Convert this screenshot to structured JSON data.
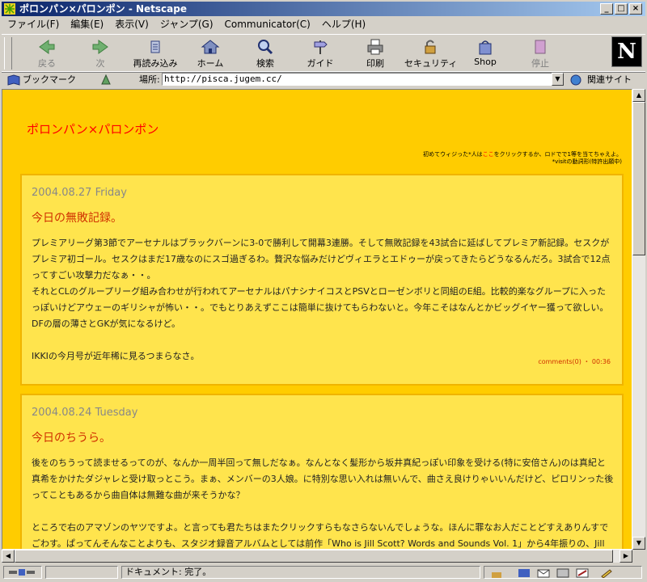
{
  "window": {
    "title": "ポロンパン×パロンポン - Netscape"
  },
  "menu": [
    "ファイル(F)",
    "編集(E)",
    "表示(V)",
    "ジャンプ(G)",
    "Communicator(C)",
    "ヘルプ(H)"
  ],
  "toolbar": {
    "back": "戻る",
    "forward": "次",
    "reload": "再読み込み",
    "home": "ホーム",
    "search": "検索",
    "guide": "ガイド",
    "print": "印刷",
    "security": "セキュリティ",
    "shop": "Shop",
    "stop": "停止",
    "logo": "N"
  },
  "location": {
    "bookmarks": "ブックマーク",
    "label": "場所:",
    "url": "http://pisca.jugem.cc/",
    "related": "関連サイト"
  },
  "status": {
    "text": "ドキュメント: 完了。"
  },
  "page": {
    "site_title": "ポロンパン×パロンポン",
    "note_line1_a": "初めてウィジった*人は",
    "note_link": "ここ",
    "note_line1_b": "をクリックするか、ロドでで1等を当てちゃえよ。",
    "note_line2": "*visitの動詞形(特許出願中)",
    "entries": [
      {
        "date": "2004.08.27 Friday",
        "title": "今日の無敗記録。",
        "p1": "プレミアリーグ第3節でアーセナルはブラックバーンに3-0で勝利して開幕3連勝。そして無敗記録を43試合に延ばしてプレミア新記録。セスクがプレミア初ゴール。セスクはまだ17歳なのにスゴ過ぎるわ。贅沢な悩みだけどヴィエラとエドゥーが戻ってきたらどうなるんだろ。3試合で12点ってすごい攻撃力だなぁ・・。",
        "p2": "それとCLのグループリーグ組み合わせが行われてアーセナルはパナシナイコスとPSVとローゼンボリと同組のE組。比較的楽なグループに入ったっぽいけどアウェーのギリシャが怖い・・。でもとりあえずここは簡単に抜けてもらわないと。今年こそはなんとかビッグイヤー獲って欲しい。DFの層の薄さとGKが気になるけど。",
        "p3": "IKKIの今月号が近年稀に見るつまらなさ。",
        "meta": "comments(0) ・ 00:36"
      },
      {
        "date": "2004.08.24 Tuesday",
        "title": "今日のちうら。",
        "p1": "後をのちうって読ませるってのが、なんか一周半回って無しだなぁ。なんとなく髪形から坂井真紀っぽい印象を受ける(特に安倍さん)のは真紀と真希をかけたダジャレと受け取っとこう。まぁ、メンバーの3人娘。に特別な思い入れは無いんで、曲さえ良けりゃいいんだけど、ピロリンった後ってこともあるから曲自体は無難な曲が来そうかな？",
        "p2": "ところで右のアマゾンのヤツですよ。と言っても君たちはまたクリックすらもなさらないんでしょうな。ほんに罪なお人だことどすえありんすでごわす。ぱってんそんなことよりも、スタジオ録音アルバムとしては前作「Who is Jill Scott? Words and Sounds Vol. 1」から4年振りの、Jill Scottの新譜が遂に出ますよ。試聴した感じでは前作よりも力強く歌ってる曲もあったり、クールな感じや柔らかさを抑えてる向きもありそうだったりするけど、"
      }
    ]
  },
  "colors": {
    "page_bg": "#ffcc00",
    "entry_bg": "#ffe44d",
    "title_red": "#ff0000",
    "accent": "#d03000"
  }
}
